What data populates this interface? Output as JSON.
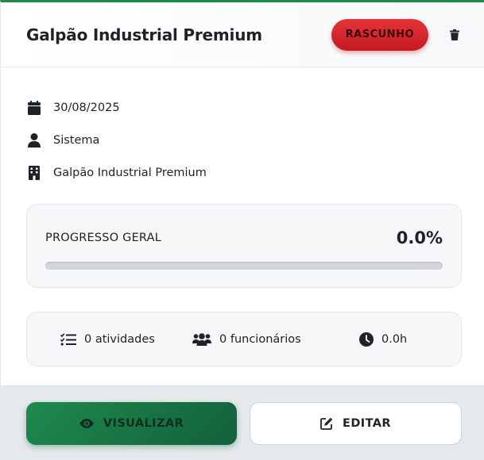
{
  "header": {
    "title": "Galpão Industrial Premium",
    "status_badge": "RASCUNHO"
  },
  "info": {
    "date": "30/08/2025",
    "user": "Sistema",
    "site": "Galpão Industrial Premium"
  },
  "progress": {
    "label": "PROGRESSO GERAL",
    "value_text": "0.0%",
    "fraction": 0
  },
  "stats": {
    "activities": "0 atividades",
    "employees": "0 funcionários",
    "hours": "0.0h"
  },
  "actions": {
    "view_label": "VISUALIZAR",
    "edit_label": "EDITAR"
  },
  "icons": {
    "header": [
      "trash-icon"
    ],
    "info": [
      "calendar-icon",
      "user-icon",
      "building-icon"
    ],
    "stats": [
      "tasks-list-icon",
      "users-icon",
      "clock-icon"
    ],
    "actions": [
      "eye-icon",
      "edit-icon"
    ]
  },
  "colors": {
    "accent": "#1e8a4f",
    "status_badge": "#d9272d"
  }
}
